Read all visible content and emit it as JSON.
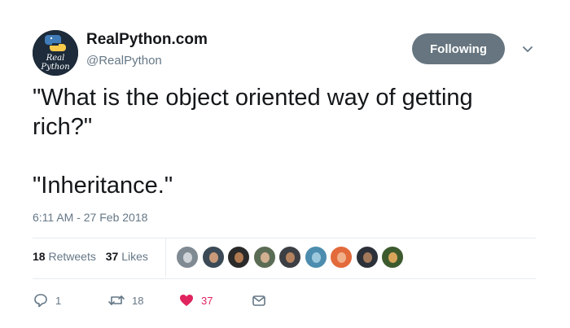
{
  "author": {
    "name": "RealPython.com",
    "handle": "@RealPython",
    "avatar_text": "Real Python",
    "avatar_colors": {
      "bg": "#1d2b3a",
      "blue": "#3f7cb8",
      "yellow": "#f6c94a"
    }
  },
  "follow_button": {
    "label": "Following",
    "color": "#66757f"
  },
  "tweet": {
    "text": "\"What is the object oriented way of getting rich?\"\n\n\"Inheritance.\"",
    "timestamp": "6:11 AM - 27 Feb 2018"
  },
  "stats": {
    "retweets_count": "18",
    "retweets_label": "Retweets",
    "likes_count": "37",
    "likes_label": "Likes"
  },
  "likers": [
    {
      "bg": "#7f8a93",
      "skin": "#cfd4d8"
    },
    {
      "bg": "#3b4a56",
      "skin": "#c89a7a"
    },
    {
      "bg": "#2a2a2a",
      "skin": "#b07a52"
    },
    {
      "bg": "#5b6c55",
      "skin": "#d2b092"
    },
    {
      "bg": "#3c3f44",
      "skin": "#b5835f"
    },
    {
      "bg": "#4c8cae",
      "skin": "#9cc8de"
    },
    {
      "bg": "#e36a3b",
      "skin": "#f0b08a"
    },
    {
      "bg": "#2c3139",
      "skin": "#a3795c"
    },
    {
      "bg": "#3d5a2e",
      "skin": "#d8a55a"
    }
  ],
  "actions": {
    "reply_count": "1",
    "retweet_count": "18",
    "like_count": "37",
    "icon_gray": "#657786",
    "like_color": "#e0245e"
  }
}
